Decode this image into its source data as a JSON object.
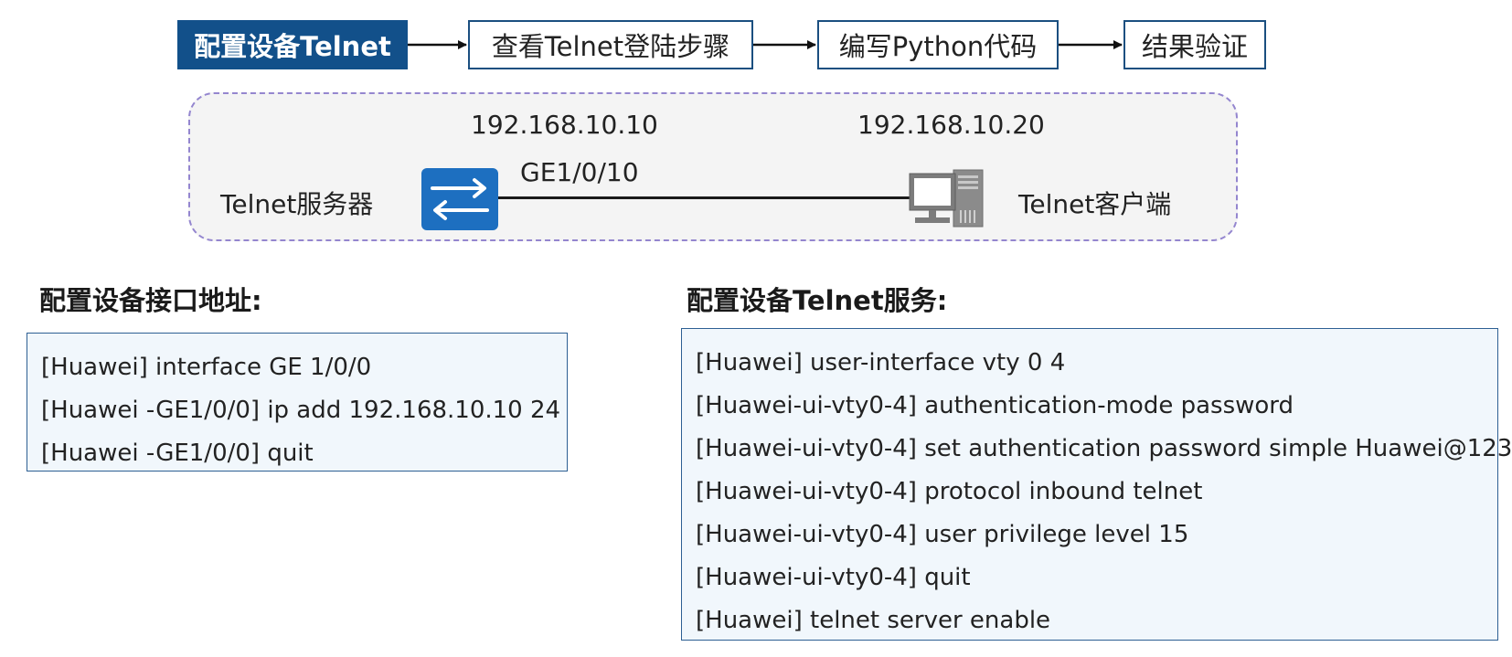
{
  "flow": {
    "steps": [
      {
        "label": "配置设备Telnet",
        "active": true
      },
      {
        "label": "查看Telnet登陆步骤",
        "active": false
      },
      {
        "label": "编写Python代码",
        "active": false
      },
      {
        "label": "结果验证",
        "active": false
      }
    ]
  },
  "topology": {
    "server_label": "Telnet服务器",
    "client_label": "Telnet客户端",
    "server_ip": "192.168.10.10",
    "client_ip": "192.168.10.20",
    "interface": "GE1/0/10",
    "server_icon": "switch-icon",
    "client_icon": "pc-icon"
  },
  "interface_config": {
    "heading": "配置设备接口地址:",
    "lines": [
      "[Huawei] interface GE 1/0/0",
      "[Huawei -GE1/0/0] ip add 192.168.10.10 24",
      "[Huawei -GE1/0/0] quit"
    ]
  },
  "telnet_config": {
    "heading": "配置设备Telnet服务:",
    "lines": [
      "[Huawei] user-interface vty 0 4",
      "[Huawei-ui-vty0-4] authentication-mode password",
      "[Huawei-ui-vty0-4] set authentication password simple Huawei@123",
      "[Huawei-ui-vty0-4] protocol inbound telnet",
      "[Huawei-ui-vty0-4] user privilege level 15",
      "[Huawei-ui-vty0-4] quit",
      "[Huawei] telnet server enable"
    ]
  },
  "colors": {
    "active_step": "#12508a",
    "step_border": "#1b4f80",
    "switch": "#1d6fc0",
    "frame_dash": "#9486cf",
    "code_bg": "#f1f7fc",
    "code_border": "#2d5f93"
  }
}
